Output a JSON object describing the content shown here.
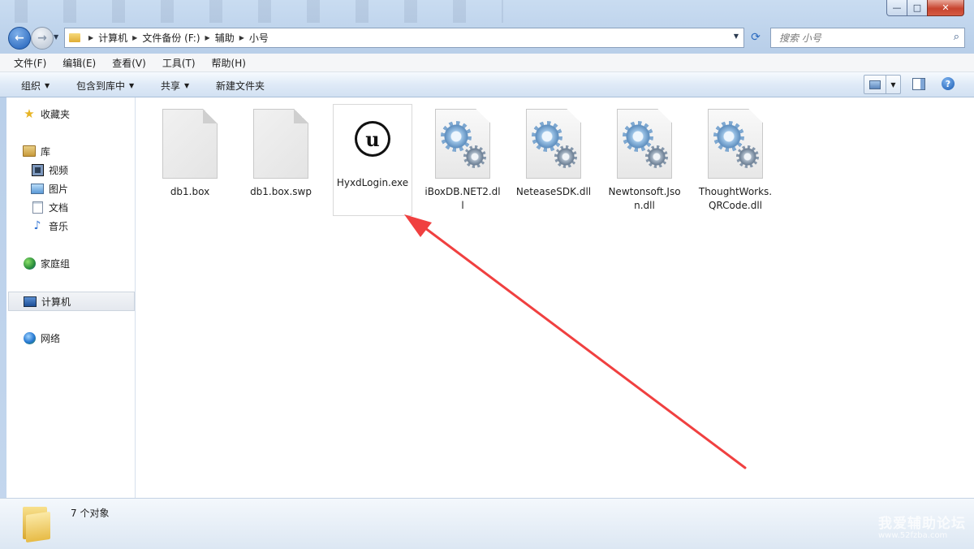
{
  "window": {
    "controls": {
      "minimize": "—",
      "maximize": "□",
      "close": "✕"
    }
  },
  "nav": {
    "breadcrumb": [
      "计算机",
      "文件备份 (F:)",
      "辅助",
      "小号"
    ],
    "search_placeholder": "搜索 小号"
  },
  "menu": [
    "文件(F)",
    "编辑(E)",
    "查看(V)",
    "工具(T)",
    "帮助(H)"
  ],
  "toolbar": {
    "organize": "组织",
    "include_library": "包含到库中",
    "share": "共享",
    "new_folder": "新建文件夹"
  },
  "sidebar": {
    "favorites": "收藏夹",
    "libraries": "库",
    "videos": "视频",
    "pictures": "图片",
    "documents": "文档",
    "music": "音乐",
    "homegroup": "家庭组",
    "computer": "计算机",
    "network": "网络"
  },
  "files": [
    {
      "name": "db1.box",
      "icon": "blank-file-icon"
    },
    {
      "name": "db1.box.swp",
      "icon": "blank-file-icon"
    },
    {
      "name": "HyxdLogin.exe",
      "icon": "unreal-engine-icon"
    },
    {
      "name": "iBoxDB.NET2.dll",
      "icon": "dll-gear-icon"
    },
    {
      "name": "NeteaseSDK.dll",
      "icon": "dll-gear-icon"
    },
    {
      "name": "Newtonsoft.Json.dll",
      "icon": "dll-gear-icon"
    },
    {
      "name": "ThoughtWorks.QRCode.dll",
      "icon": "dll-gear-icon"
    }
  ],
  "status": {
    "count_text": "7 个对象"
  },
  "watermark": {
    "title": "我爱辅助论坛",
    "url": "www.52fzba.com"
  },
  "colors": {
    "annotation_arrow": "#f04040",
    "selection": "#cde8ff"
  }
}
